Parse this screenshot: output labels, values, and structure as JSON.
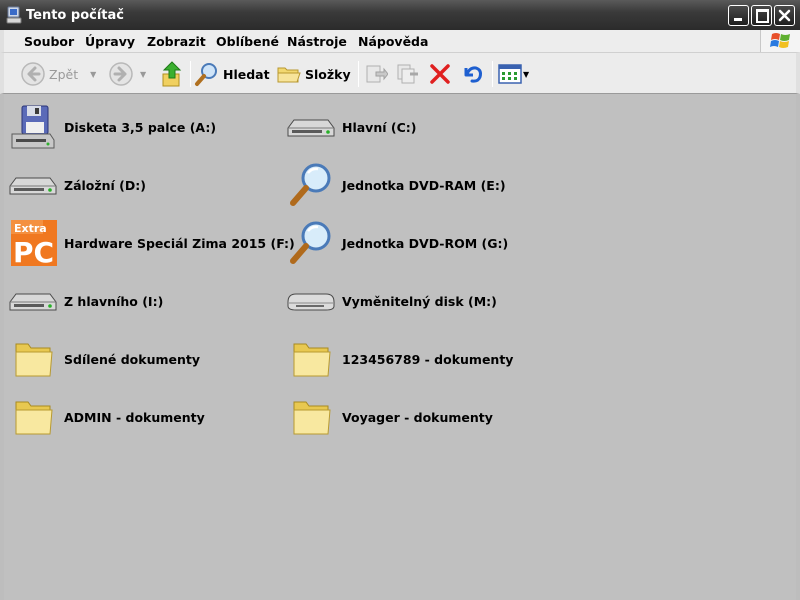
{
  "window": {
    "title": "Tento počítač"
  },
  "menu": {
    "items": [
      "Soubor",
      "Úpravy",
      "Zobrazit",
      "Oblíbené",
      "Nástroje",
      "Nápověda"
    ]
  },
  "toolbar": {
    "back_label": "Zpět",
    "search_label": "Hledat",
    "folders_label": "Složky"
  },
  "items": [
    {
      "label": "Disketa 3,5 palce (A:)",
      "icon": "floppy-drive-icon"
    },
    {
      "label": "Hlavní (C:)",
      "icon": "hard-drive-icon"
    },
    {
      "label": "Záložní (D:)",
      "icon": "hard-drive-icon"
    },
    {
      "label": "Jednotka DVD-RAM (E:)",
      "icon": "magnifier-icon"
    },
    {
      "label": "Hardware Speciál Zima 2015 (F:)",
      "icon": "extra-pc-logo-icon"
    },
    {
      "label": "Jednotka DVD-ROM (G:)",
      "icon": "magnifier-icon"
    },
    {
      "label": "Z hlavního (I:)",
      "icon": "hard-drive-icon"
    },
    {
      "label": "Vyměnitelný disk (M:)",
      "icon": "removable-disk-icon"
    },
    {
      "label": "Sdílené dokumenty",
      "icon": "folder-icon"
    },
    {
      "label": "123456789 - dokumenty",
      "icon": "folder-icon"
    },
    {
      "label": "ADMIN - dokumenty",
      "icon": "folder-icon"
    },
    {
      "label": "Voyager - dokumenty",
      "icon": "folder-icon"
    }
  ],
  "logo_text": "Extra PC",
  "colors": {
    "titlebar": "#2b2b2b",
    "content_bg": "#c0c0c0",
    "delete_red": "#e02020",
    "undo_blue": "#1e5fd0"
  }
}
